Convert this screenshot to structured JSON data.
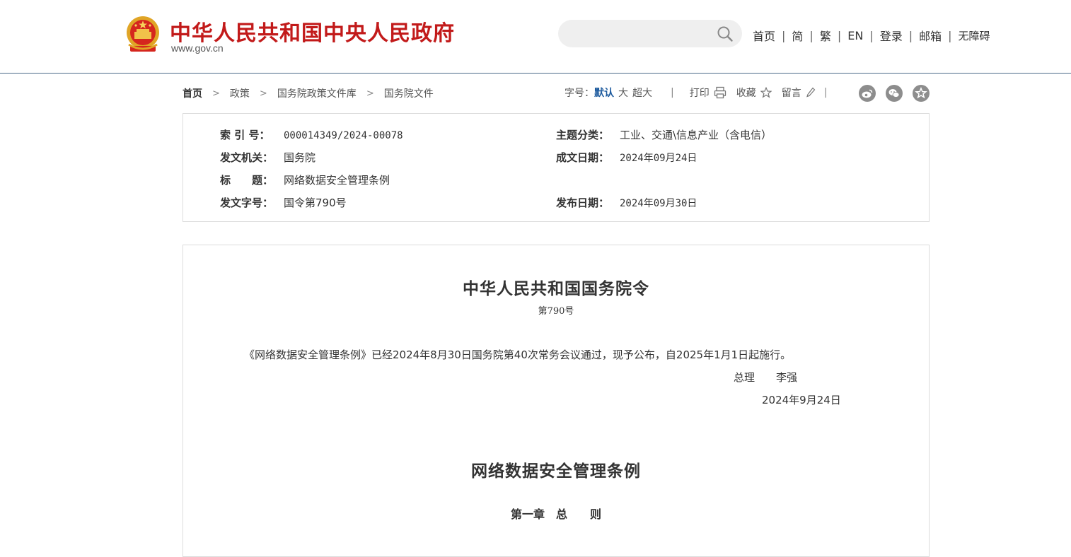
{
  "header": {
    "site_name": "中华人民共和国中央人民政府",
    "domain": "www.gov.cn",
    "search": {
      "placeholder": ""
    },
    "nav": [
      "首页",
      "简",
      "繁",
      "EN",
      "登录",
      "邮箱",
      "无障碍"
    ],
    "nav_sep": "|"
  },
  "breadcrumb": {
    "items": [
      "首页",
      "政策",
      "国务院政策文件库",
      "国务院文件"
    ],
    "sep": ">"
  },
  "tools": {
    "font_label": "字号：",
    "font_sizes": [
      "默认",
      "大",
      "超大"
    ],
    "sep": "|",
    "print": "打印",
    "favorite": "收藏",
    "comment": "留言",
    "share_icons": [
      "weibo-icon",
      "wechat-icon",
      "star-icon"
    ]
  },
  "meta": {
    "index_label": "索 引 号：",
    "index_value": "000014349/2024-00078",
    "topic_label": "主题分类：",
    "topic_value": "工业、交通\\信息产业（含电信）",
    "issuer_label": "发文机关：",
    "issuer_value": "国务院",
    "written_label": "成文日期：",
    "written_value": "2024年09月24日",
    "title_label": "标　　题：",
    "title_value": "网络数据安全管理条例",
    "docno_label": "发文字号：",
    "docno_value": "国令第790号",
    "published_label": "发布日期：",
    "published_value": "2024年09月30日"
  },
  "document": {
    "title": "中华人民共和国国务院令",
    "number": "第790号",
    "paragraph": "《网络数据安全管理条例》已经2024年8月30日国务院第40次常务会议通过，现予公布，自2025年1月1日起施行。",
    "signer_title": "总理",
    "signer_name": "李强",
    "date": "2024年9月24日",
    "regulation_title": "网络数据安全管理条例",
    "chapter": "第一章　总　　则"
  },
  "colors": {
    "brand_red": "#c21a1a",
    "active_blue": "#1e5b9e",
    "border": "#dcdcdc",
    "header_rule": "#4b6b8a"
  }
}
